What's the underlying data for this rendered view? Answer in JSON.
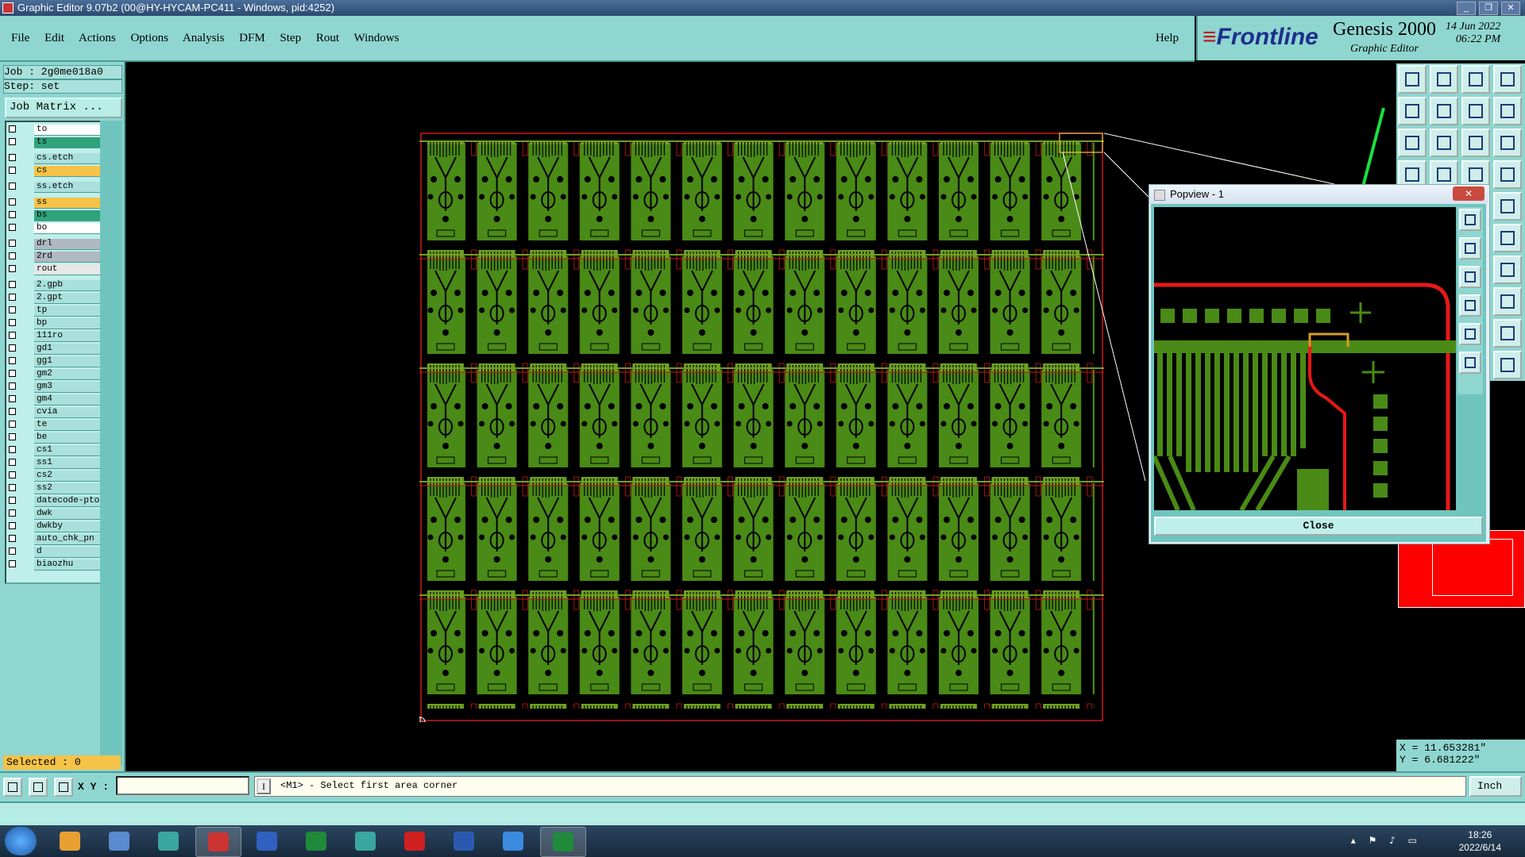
{
  "window": {
    "title": "Graphic Editor 9.07b2 (00@HY-HYCAM-PC411 - Windows, pid:4252)"
  },
  "menu": [
    "File",
    "Edit",
    "Actions",
    "Options",
    "Analysis",
    "DFM",
    "Step",
    "Rout",
    "Windows"
  ],
  "help": "Help",
  "brand": {
    "logo_text": "Frontline",
    "product": "Genesis 2000",
    "subtitle": "Graphic Editor",
    "date": "14 Jun 2022",
    "time": "06:22 PM"
  },
  "job": {
    "job_label": "Job : 2g0me018a0",
    "step_label": "Step: set",
    "matrix_button": "Job Matrix ..."
  },
  "layers": [
    {
      "name": "to",
      "color": "#ffffff"
    },
    {
      "name": "ts",
      "color": "#2fa37a"
    },
    {
      "name": "cs.etch",
      "color": "#a9e0db"
    },
    {
      "name": "cs",
      "color": "#f5c347"
    },
    {
      "name": "ss.etch",
      "color": "#a9e0db"
    },
    {
      "name": "ss",
      "color": "#f5c347"
    },
    {
      "name": "bs",
      "color": "#2fa37a"
    },
    {
      "name": "bo",
      "color": "#ffffff"
    },
    {
      "name": "drl",
      "color": "#b0b8c0"
    },
    {
      "name": "2rd",
      "color": "#b0b8c0"
    },
    {
      "name": "rout",
      "color": "#e8e8e8"
    },
    {
      "name": "2.gpb",
      "color": "#a9e0db"
    },
    {
      "name": "2.gpt",
      "color": "#a9e0db"
    },
    {
      "name": "tp",
      "color": "#a9e0db"
    },
    {
      "name": "bp",
      "color": "#a9e0db"
    },
    {
      "name": "111ro",
      "color": "#a9e0db"
    },
    {
      "name": "gd1",
      "color": "#a9e0db"
    },
    {
      "name": "gg1",
      "color": "#a9e0db"
    },
    {
      "name": "gm2",
      "color": "#a9e0db"
    },
    {
      "name": "gm3",
      "color": "#a9e0db"
    },
    {
      "name": "gm4",
      "color": "#a9e0db"
    },
    {
      "name": "cvia",
      "color": "#a9e0db"
    },
    {
      "name": "te",
      "color": "#a9e0db"
    },
    {
      "name": "be",
      "color": "#a9e0db"
    },
    {
      "name": "cs1",
      "color": "#a9e0db"
    },
    {
      "name": "ss1",
      "color": "#a9e0db"
    },
    {
      "name": "cs2",
      "color": "#a9e0db"
    },
    {
      "name": "ss2",
      "color": "#a9e0db"
    },
    {
      "name": "datecode-pto",
      "color": "#a9e0db"
    },
    {
      "name": "dwk",
      "color": "#a9e0db"
    },
    {
      "name": "dwkby",
      "color": "#a9e0db"
    },
    {
      "name": "auto_chk_pn",
      "color": "#a9e0db"
    },
    {
      "name": "d",
      "color": "#a9e0db"
    },
    {
      "name": "biaozhu",
      "color": "#a9e0db"
    }
  ],
  "selected": "Selected : 0",
  "popview": {
    "title": "Popview - 1",
    "close_label": "Close"
  },
  "coords": {
    "x": "X = 11.653281\"",
    "y": "Y = 6.681222\""
  },
  "command": {
    "xy_label": "X Y :",
    "message": "<M1> - Select first area corner",
    "unit": "Inch"
  },
  "clock": {
    "time": "18:26",
    "date": "2022/6/14"
  },
  "colors": {
    "panel": "#8fd6d0",
    "board_green": "#4a8a16",
    "route_red": "#d01818",
    "arrow_green": "#18e040"
  }
}
